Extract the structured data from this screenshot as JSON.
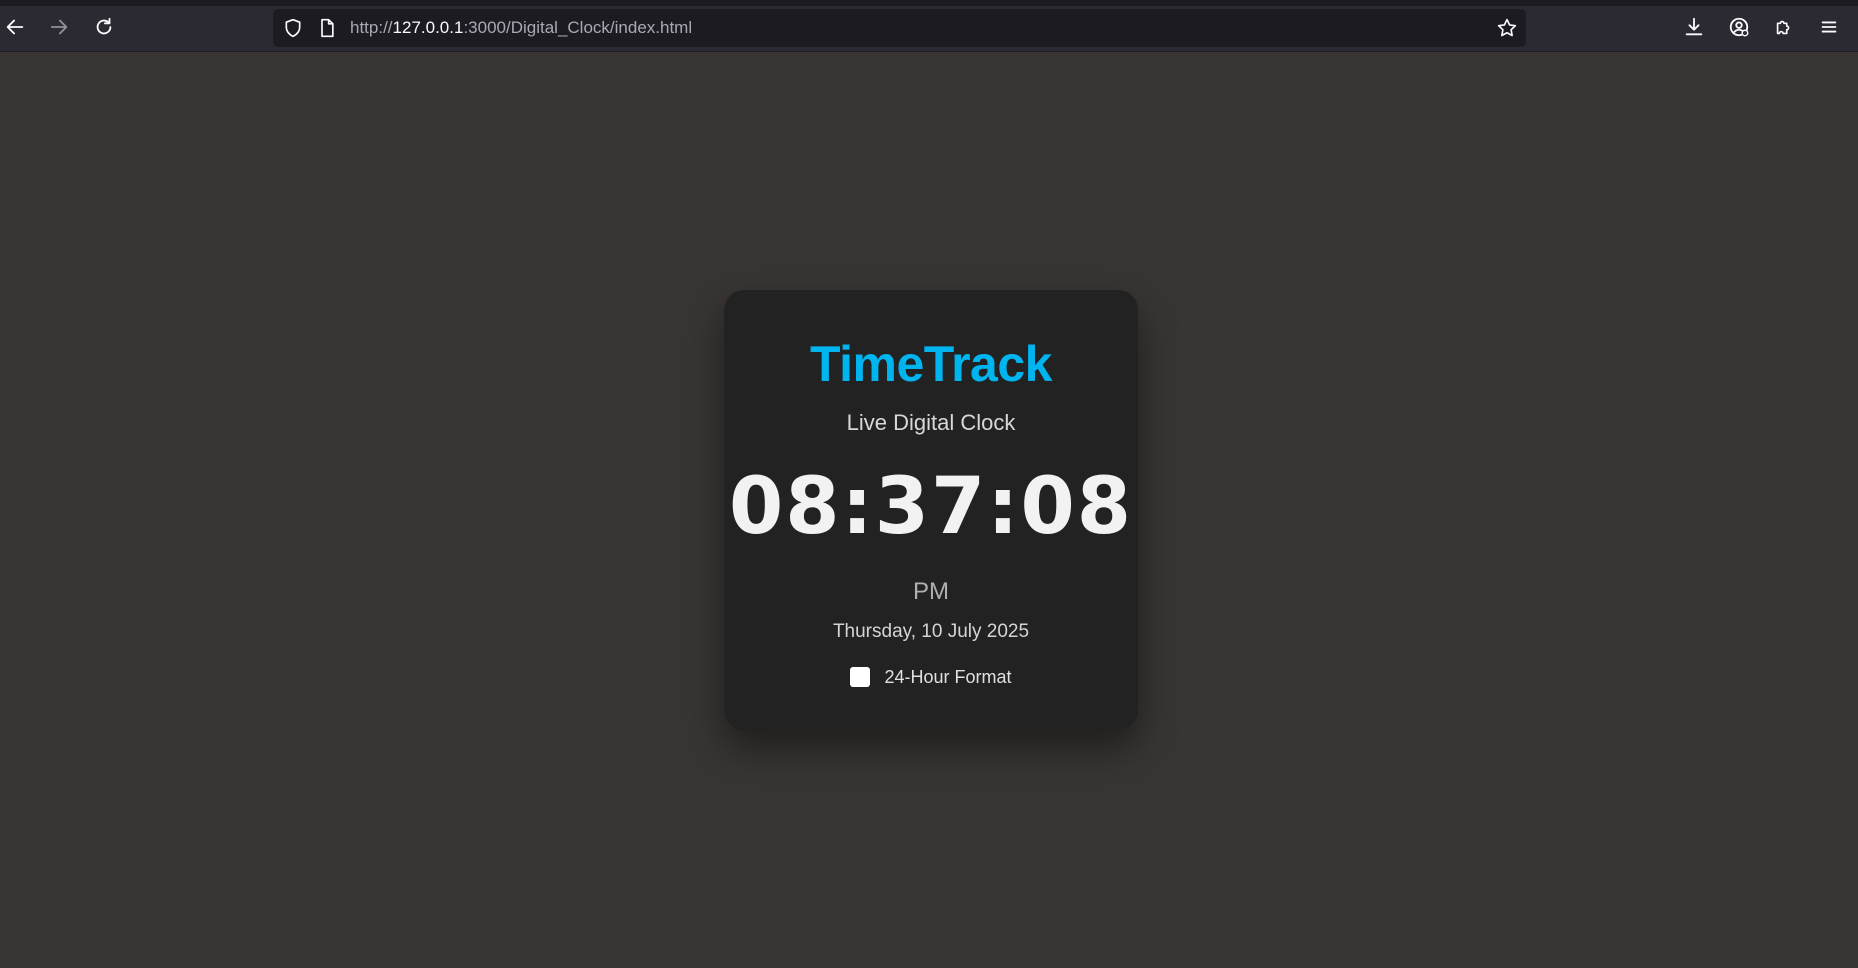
{
  "browser": {
    "url_prefix": "http://",
    "url_host": "127.0.0.1",
    "url_rest": ":3000/Digital_Clock/index.html",
    "icons": {
      "back": "arrow-left-icon",
      "forward": "arrow-right-icon",
      "reload": "reload-icon",
      "shield": "shield-icon",
      "page": "page-icon",
      "bookmark": "star-icon",
      "downloads": "download-icon",
      "account": "account-icon",
      "extensions": "puzzle-icon",
      "menu": "hamburger-icon"
    }
  },
  "clock": {
    "title": "TimeTrack",
    "subtitle": "Live Digital Clock",
    "time": "08:37:08",
    "ampm": "PM",
    "date": "Thursday, 10 July 2025",
    "format_label": "24-Hour Format",
    "format_checked": false
  },
  "colors": {
    "page_bg": "#383533",
    "card_bg": "#222222",
    "accent": "#00b4f0",
    "toolbar_bg": "#2b2a33"
  }
}
